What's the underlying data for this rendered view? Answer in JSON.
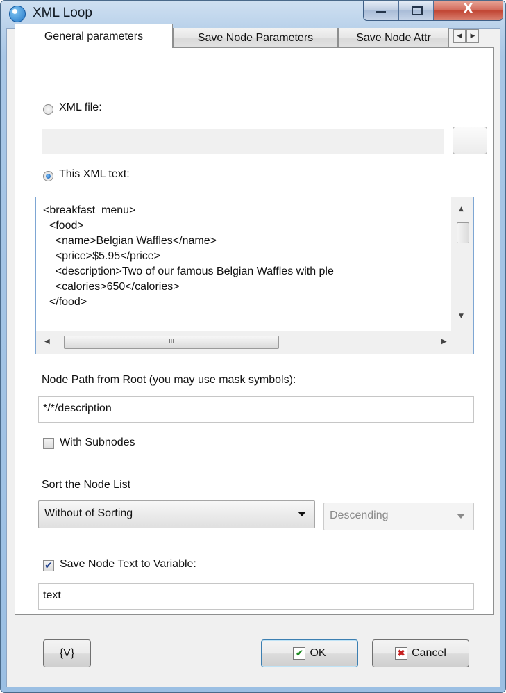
{
  "window": {
    "title": "XML Loop",
    "close_glyph": "X"
  },
  "tabs": [
    {
      "label": "General parameters",
      "active": true
    },
    {
      "label": "Save Node Parameters",
      "active": false
    },
    {
      "label": "Save Node Attr",
      "active": false
    }
  ],
  "source": {
    "xml_file_label": "XML file:",
    "xml_file_value": "",
    "xml_text_label": "This XML text:",
    "selected": "xml_text",
    "xml_lines": [
      "<breakfast_menu>",
      "  <food>",
      "    <name>Belgian Waffles</name>",
      "    <price>$5.95</price>",
      "    <description>Two of our famous Belgian Waffles with ple",
      "    <calories>650</calories>",
      "  </food>"
    ],
    "hscroll_thumb_glyph": "III"
  },
  "node_path": {
    "label": "Node Path from Root (you may use mask symbols):",
    "value": "*/*/description"
  },
  "subnodes": {
    "label": "With Subnodes",
    "checked": false
  },
  "sort": {
    "label": "Sort the Node List",
    "mode": "Without of Sorting",
    "order": "Descending"
  },
  "save_text": {
    "label": "Save Node Text to Variable:",
    "checked": true,
    "value": "text"
  },
  "buttons": {
    "variables": "{V}",
    "ok": "OK",
    "cancel": "Cancel"
  }
}
